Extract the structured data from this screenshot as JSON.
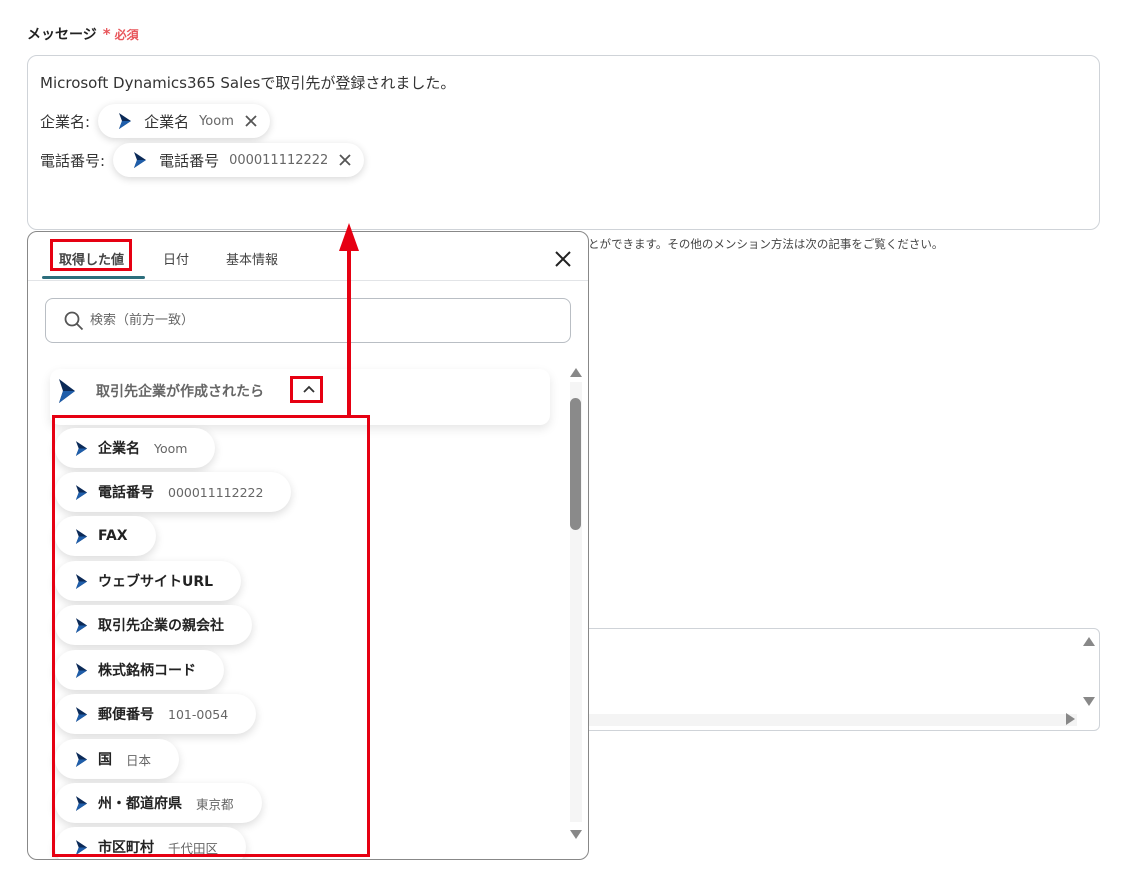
{
  "field": {
    "label": "メッセージ",
    "required_star": "*",
    "required_text": "必須"
  },
  "message": {
    "line1": "Microsoft Dynamics365 Salesで取引先が登録されました。",
    "rows": [
      {
        "label": "企業名:",
        "pill_name": "企業名",
        "pill_value": "Yoom"
      },
      {
        "label": "電話番号:",
        "pill_name": "電話番号",
        "pill_value": "000011112222"
      }
    ]
  },
  "helper_text": "とができます。その他のメンション方法は次の記事をご覧ください。",
  "popup": {
    "tabs": [
      {
        "label": "取得した値",
        "active": true
      },
      {
        "label": "日付",
        "active": false
      },
      {
        "label": "基本情報",
        "active": false
      }
    ],
    "search_placeholder": "検索（前方一致）",
    "group_title": "取引先企業が作成されたら",
    "items": [
      {
        "name": "企業名",
        "value": "Yoom"
      },
      {
        "name": "電話番号",
        "value": "000011112222"
      },
      {
        "name": "FAX",
        "value": ""
      },
      {
        "name": "ウェブサイトURL",
        "value": ""
      },
      {
        "name": "取引先企業の親会社",
        "value": ""
      },
      {
        "name": "株式銘柄コード",
        "value": ""
      },
      {
        "name": "郵便番号",
        "value": "101-0054"
      },
      {
        "name": "国",
        "value": "日本"
      },
      {
        "name": "州・都道府県",
        "value": "東京都"
      },
      {
        "name": "市区町村",
        "value": "千代田区"
      }
    ]
  },
  "icons": {
    "dynamics": "dynamics-logo-icon",
    "close": "close-icon",
    "search": "search-icon",
    "chevron": "chevron-up-icon"
  },
  "colors": {
    "required": "#e8565b",
    "highlight": "#e60012",
    "tab_underline": "#2c6e7c",
    "dynamics_logo": "#0b2a58"
  }
}
